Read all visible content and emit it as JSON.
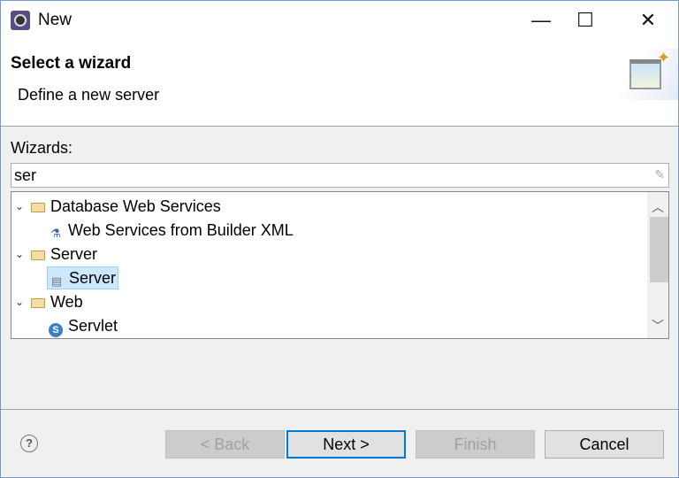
{
  "window": {
    "title": "New",
    "minimize": "—",
    "maximize": "☐",
    "close": "✕"
  },
  "header": {
    "title": "Select a wizard",
    "subtitle": "Define a new server"
  },
  "wizards_label": "Wizards:",
  "filter": {
    "value": "ser"
  },
  "tree": [
    {
      "label": "Database Web Services",
      "type": "folder",
      "expanded": true
    },
    {
      "label": "Web Services from Builder XML",
      "type": "item",
      "icon": "web-service-icon"
    },
    {
      "label": "Server",
      "type": "folder",
      "expanded": true
    },
    {
      "label": "Server",
      "type": "item",
      "icon": "server-icon",
      "selected": true
    },
    {
      "label": "Web",
      "type": "folder",
      "expanded": true
    },
    {
      "label": "Servlet",
      "type": "item",
      "icon": "servlet-icon"
    }
  ],
  "buttons": {
    "back": "< Back",
    "next": "Next >",
    "finish": "Finish",
    "cancel": "Cancel",
    "help": "?"
  }
}
